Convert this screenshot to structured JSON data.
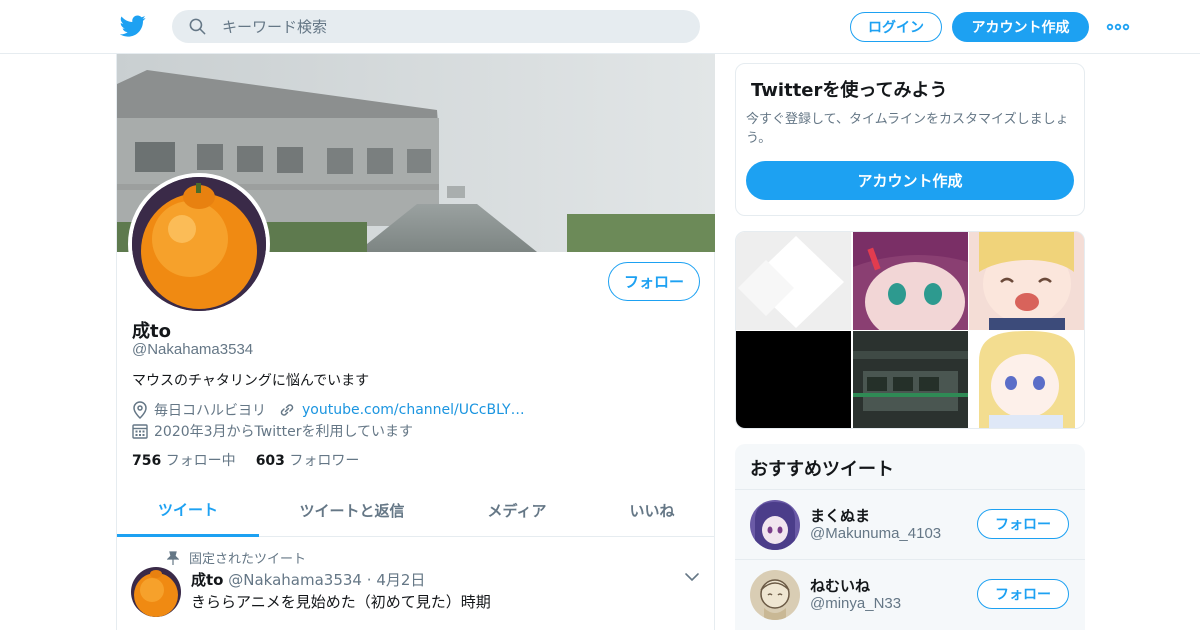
{
  "header": {
    "search_placeholder": "キーワード検索",
    "login_label": "ログイン",
    "signup_label": "アカウント作成"
  },
  "profile": {
    "follow_label": "フォロー",
    "name": "成to",
    "handle": "@Nakahama3534",
    "bio": "マウスのチャタリングに悩んでいます",
    "location": "毎日コハルビヨリ",
    "website": "youtube.com/channel/UCcBLY…",
    "joined": "2020年3月からTwitterを利用しています",
    "following_count": "756",
    "following_label": "フォロー中",
    "followers_count": "603",
    "followers_label": "フォロワー"
  },
  "tabs": [
    {
      "label": "ツイート"
    },
    {
      "label": "ツイートと返信"
    },
    {
      "label": "メディア"
    },
    {
      "label": "いいね"
    }
  ],
  "pinned_tweet": {
    "pin_label": "固定されたツイート",
    "author": "成to",
    "handle": "@Nakahama3534",
    "date": "4月2日",
    "text": "きららアニメを見始めた（初めて見た）時期"
  },
  "signup_card": {
    "title": "Twitterを使ってみよう",
    "description": "今すぐ登録して、タイムラインをカスタマイズしましょう。",
    "button_label": "アカウント作成"
  },
  "recommended": {
    "title": "おすすめツイート",
    "items": [
      {
        "name": "まくぬま",
        "handle": "@Makunuma_4103",
        "button_label": "フォロー"
      },
      {
        "name": "ねむいね",
        "handle": "@minya_N33",
        "button_label": "フォロー"
      }
    ]
  },
  "colors": {
    "accent": "#1da1f2",
    "link": "#1b95e0",
    "secondary_text": "#657786",
    "border": "#e6ecf0"
  },
  "icons": {
    "logo": "twitter-bird-icon",
    "search": "search-icon",
    "more": "more-dots-icon",
    "location": "location-pin-icon",
    "link": "link-icon",
    "calendar": "calendar-icon",
    "pin": "pin-icon",
    "chevron": "chevron-down-icon"
  }
}
